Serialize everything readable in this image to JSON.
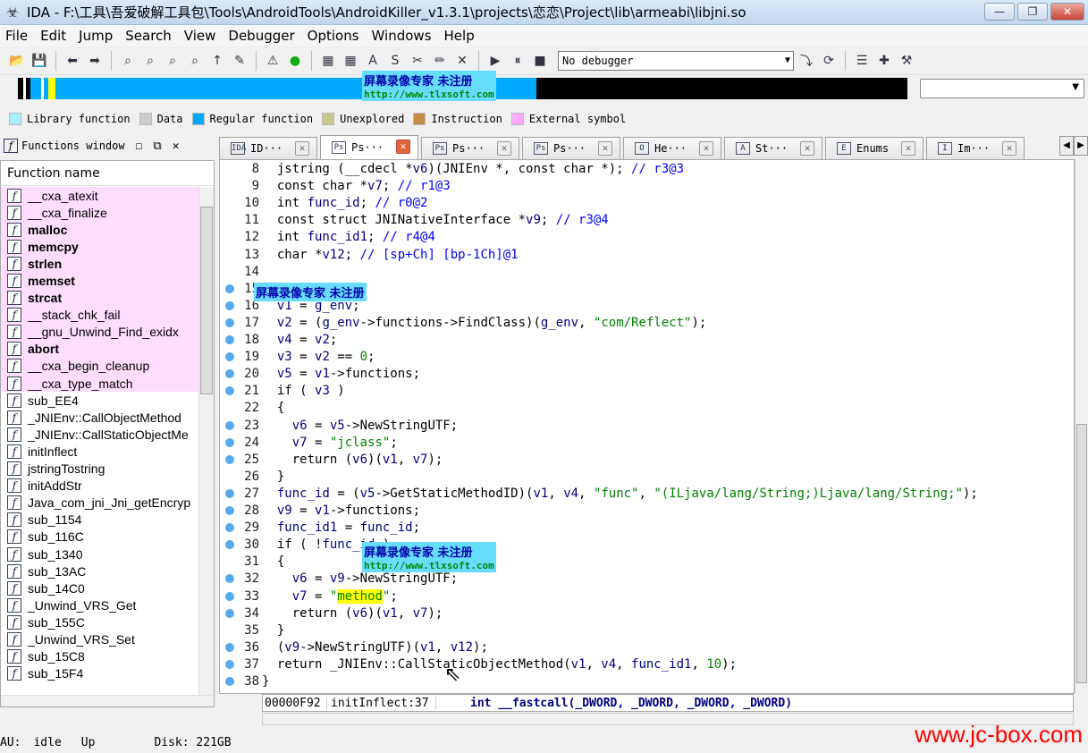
{
  "window": {
    "title": "IDA - F:\\工具\\吾爱破解工具包\\Tools\\AndroidTools\\AndroidKiller_v1.3.1\\projects\\恋恋\\Project\\lib\\armeabi\\libjni.so",
    "minimize": "—",
    "maximize": "❐",
    "close": "✕"
  },
  "menu": [
    "File",
    "Edit",
    "Jump",
    "Search",
    "View",
    "Debugger",
    "Options",
    "Windows",
    "Help"
  ],
  "toolbar": {
    "debugger_select": "No debugger"
  },
  "legend": [
    {
      "label": "Library function",
      "color": "#a8f0ff"
    },
    {
      "label": "Data",
      "color": "#cccccc"
    },
    {
      "label": "Regular function",
      "color": "#00aaff"
    },
    {
      "label": "Unexplored",
      "color": "#c8c88c"
    },
    {
      "label": "Instruction",
      "color": "#c88c4a"
    },
    {
      "label": "External symbol",
      "color": "#ffaaff"
    }
  ],
  "functions_window": {
    "title": "Functions window",
    "column": "Function name",
    "items": [
      {
        "name": "__cxa_atexit",
        "lib": true,
        "bold": false
      },
      {
        "name": "__cxa_finalize",
        "lib": true,
        "bold": false
      },
      {
        "name": "malloc",
        "lib": true,
        "bold": true
      },
      {
        "name": "memcpy",
        "lib": true,
        "bold": true
      },
      {
        "name": "strlen",
        "lib": true,
        "bold": true
      },
      {
        "name": "memset",
        "lib": true,
        "bold": true
      },
      {
        "name": "strcat",
        "lib": true,
        "bold": true
      },
      {
        "name": "__stack_chk_fail",
        "lib": true,
        "bold": false
      },
      {
        "name": "__gnu_Unwind_Find_exidx",
        "lib": true,
        "bold": false
      },
      {
        "name": "abort",
        "lib": true,
        "bold": true
      },
      {
        "name": "__cxa_begin_cleanup",
        "lib": true,
        "bold": false
      },
      {
        "name": "__cxa_type_match",
        "lib": true,
        "bold": false
      },
      {
        "name": "sub_EE4",
        "lib": false,
        "bold": false
      },
      {
        "name": "_JNIEnv::CallObjectMethod",
        "lib": false,
        "bold": false
      },
      {
        "name": "_JNIEnv::CallStaticObjectMe",
        "lib": false,
        "bold": false
      },
      {
        "name": "initInflect",
        "lib": false,
        "bold": false
      },
      {
        "name": "jstringTostring",
        "lib": false,
        "bold": false
      },
      {
        "name": "initAddStr",
        "lib": false,
        "bold": false
      },
      {
        "name": "Java_com_jni_Jni_getEncryp",
        "lib": false,
        "bold": false
      },
      {
        "name": "sub_1154",
        "lib": false,
        "bold": false
      },
      {
        "name": "sub_116C",
        "lib": false,
        "bold": false
      },
      {
        "name": "sub_1340",
        "lib": false,
        "bold": false
      },
      {
        "name": "sub_13AC",
        "lib": false,
        "bold": false
      },
      {
        "name": "sub_14C0",
        "lib": false,
        "bold": false
      },
      {
        "name": "_Unwind_VRS_Get",
        "lib": false,
        "bold": false
      },
      {
        "name": "sub_155C",
        "lib": false,
        "bold": false
      },
      {
        "name": "_Unwind_VRS_Set",
        "lib": false,
        "bold": false
      },
      {
        "name": "sub_15C8",
        "lib": false,
        "bold": false
      },
      {
        "name": "sub_15F4",
        "lib": false,
        "bold": false
      }
    ]
  },
  "tabs": [
    {
      "label": "ID···",
      "icon": "IDA",
      "active": false
    },
    {
      "label": "Ps···",
      "icon": "Ps",
      "active": true
    },
    {
      "label": "Ps···",
      "icon": "Ps",
      "active": false
    },
    {
      "label": "Ps···",
      "icon": "Ps",
      "active": false
    },
    {
      "label": "He···",
      "icon": "O",
      "active": false
    },
    {
      "label": "St···",
      "icon": "A",
      "active": false
    },
    {
      "label": "Enums",
      "icon": "E",
      "active": false
    },
    {
      "label": "Im···",
      "icon": "I",
      "active": false
    }
  ],
  "code_lines": [
    {
      "n": "8",
      "dot": false,
      "html": "  <span class='kw'>jstring (__cdecl *</span><span class='var'>v6</span>)(JNIEnv *, const char *); <span class='cmt'>// r3@3</span>"
    },
    {
      "n": "9",
      "dot": false,
      "html": "  const char *<span class='var'>v7</span>; <span class='cmt'>// r1@3</span>"
    },
    {
      "n": "10",
      "dot": false,
      "html": "  int <span class='var'>func_id</span>; <span class='cmt'>// r0@2</span>"
    },
    {
      "n": "11",
      "dot": false,
      "html": "  const struct JNINativeInterface *<span class='var'>v9</span>; <span class='cmt'>// r3@4</span>"
    },
    {
      "n": "12",
      "dot": false,
      "html": "  int <span class='var'>func_id1</span>; <span class='cmt'>// r4@4</span>"
    },
    {
      "n": "13",
      "dot": false,
      "html": "  char *<span class='var'>v12</span>; <span class='cmt'>// [sp+Ch] [bp-1Ch]@1</span>"
    },
    {
      "n": "14",
      "dot": false,
      "html": ""
    },
    {
      "n": "15",
      "dot": true,
      "html": ""
    },
    {
      "n": "16",
      "dot": true,
      "html": "  <span class='var'>v1</span> = <span class='var'>g_env</span>;"
    },
    {
      "n": "17",
      "dot": true,
      "html": "  <span class='var'>v2</span> = (<span class='var'>g_env</span>-&gt;functions-&gt;FindClass)(<span class='var'>g_env</span>, <span class='str'>\"com/Reflect\"</span>);"
    },
    {
      "n": "18",
      "dot": true,
      "html": "  <span class='var'>v4</span> = <span class='var'>v2</span>;"
    },
    {
      "n": "19",
      "dot": true,
      "html": "  <span class='var'>v3</span> = <span class='var'>v2</span> == <span class='num'>0</span>;"
    },
    {
      "n": "20",
      "dot": true,
      "html": "  <span class='var'>v5</span> = <span class='var'>v1</span>-&gt;functions;"
    },
    {
      "n": "21",
      "dot": true,
      "html": "  if ( <span class='var'>v3</span> )"
    },
    {
      "n": "22",
      "dot": false,
      "html": "  {"
    },
    {
      "n": "23",
      "dot": true,
      "html": "    <span class='var'>v6</span> = <span class='var'>v5</span>-&gt;NewStringUTF;"
    },
    {
      "n": "24",
      "dot": true,
      "html": "    <span class='var'>v7</span> = <span class='str'>\"jclass\"</span>;"
    },
    {
      "n": "25",
      "dot": true,
      "html": "    return (<span class='var'>v6</span>)(<span class='var'>v1</span>, <span class='var'>v7</span>);"
    },
    {
      "n": "26",
      "dot": false,
      "html": "  }"
    },
    {
      "n": "27",
      "dot": true,
      "html": "  <span class='var'>func_id</span> = (<span class='var'>v5</span>-&gt;GetStaticMethodID)(<span class='var'>v1</span>, <span class='var'>v4</span>, <span class='str'>\"func\"</span>, <span class='str'>\"(ILjava/lang/String;)Ljava/lang/String;\"</span>);"
    },
    {
      "n": "28",
      "dot": true,
      "html": "  <span class='var'>v9</span> = <span class='var'>v1</span>-&gt;functions;"
    },
    {
      "n": "29",
      "dot": true,
      "html": "  <span class='var'>func_id1</span> = <span class='var'>func_id</span>;"
    },
    {
      "n": "30",
      "dot": true,
      "html": "  if ( !<span class='var'>func_id</span> )"
    },
    {
      "n": "31",
      "dot": false,
      "html": "  {"
    },
    {
      "n": "32",
      "dot": true,
      "html": "    <span class='var'>v6</span> = <span class='var'>v9</span>-&gt;NewStringUTF;"
    },
    {
      "n": "33",
      "dot": true,
      "html": "    <span class='var'>v7</span> = <span class='str'>\"<span class='hl'>method</span>\"</span>;"
    },
    {
      "n": "34",
      "dot": true,
      "html": "    return (<span class='var'>v6</span>)(<span class='var'>v1</span>, <span class='var'>v7</span>);"
    },
    {
      "n": "35",
      "dot": false,
      "html": "  }"
    },
    {
      "n": "36",
      "dot": true,
      "html": "  (<span class='var'>v9</span>-&gt;NewStringUTF)(<span class='var'>v1</span>, <span class='var'>v12</span>);"
    },
    {
      "n": "37",
      "dot": true,
      "html": "  return _JNIEnv::CallStaticObjectMethod(<span class='var'>v1</span>, <span class='var'>v4</span>, <span class='var'>func_id1</span>, <span class='num'>10</span>);"
    },
    {
      "n": "38",
      "dot": true,
      "html": "}"
    }
  ],
  "watermark": {
    "line1": "屏幕录像专家        未注册",
    "url": "http://www.tlxsoft.com"
  },
  "code_status": {
    "address": "00000F92",
    "location": "initInflect:37",
    "signature": "int __fastcall(_DWORD, _DWORD, _DWORD, _DWORD)"
  },
  "status": {
    "au_label": "AU:",
    "au_value": "idle",
    "direction": "Up",
    "disk": "Disk: 221GB"
  },
  "brand": "www.jc-box.com"
}
